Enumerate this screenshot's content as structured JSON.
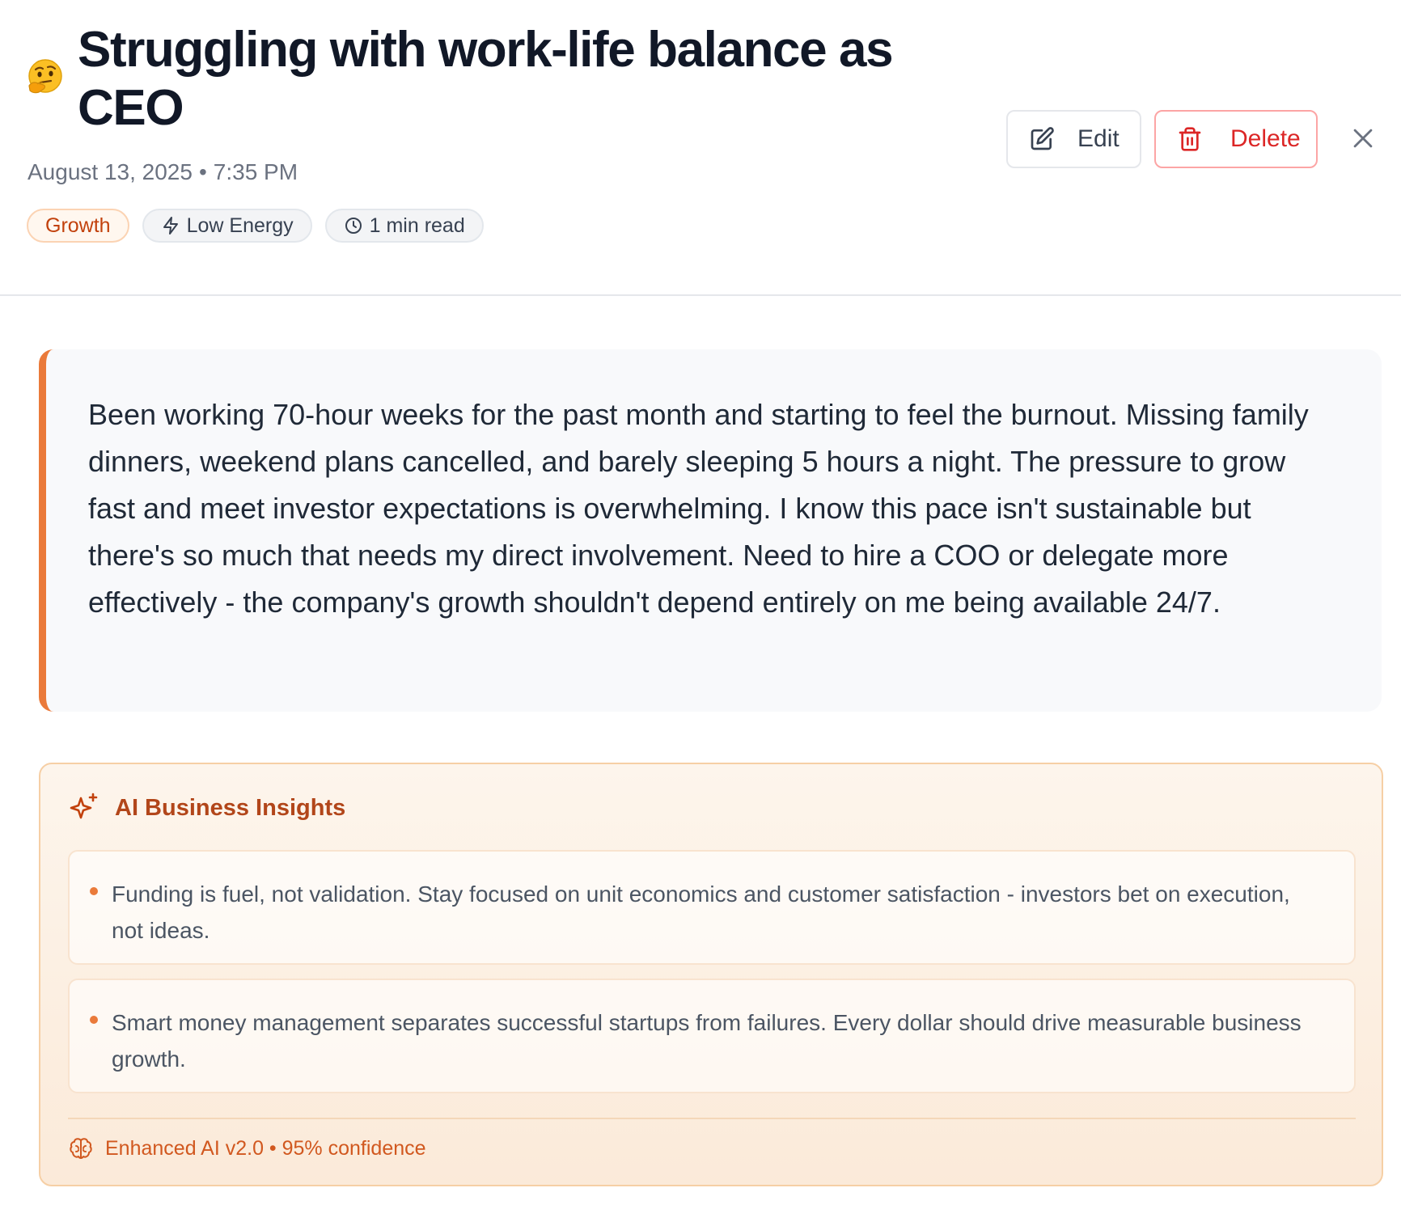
{
  "entry": {
    "mood_emoji": "🤔",
    "mood_icon": "thinking-face-icon",
    "title": "Struggling with work-life balance as CEO",
    "date": "August 13, 2025",
    "separator": "•",
    "time": "7:35 PM",
    "tags": {
      "category": "Growth",
      "energy": "Low Energy",
      "read_time": "1 min read"
    },
    "body": "Been working 70-hour weeks for the past month and starting to feel the burnout. Missing family dinners, weekend plans cancelled, and barely sleeping 5 hours a night. The pressure to grow fast and meet investor expectations is overwhelming. I know this pace isn't sustainable but there's so much that needs my direct involvement. Need to hire a COO or delegate more effectively - the company's growth shouldn't depend entirely on me being available 24/7."
  },
  "actions": {
    "edit_label": "Edit",
    "delete_label": "Delete"
  },
  "insights": {
    "heading": "AI Business Insights",
    "items": [
      {
        "text": "Funding is fuel, not validation. Stay focused on unit economics and customer satisfaction - investors bet on execution, not ideas."
      },
      {
        "text": "Smart money management separates successful startups from failures. Every dollar should drive measurable business growth."
      }
    ],
    "footer": "Enhanced AI v2.0 • 95% confidence"
  },
  "colors": {
    "accent": "#ea7a3a",
    "accent_dark": "#b2461a",
    "danger": "#dc2626",
    "text_primary": "#111827",
    "text_muted": "#6b7280"
  }
}
